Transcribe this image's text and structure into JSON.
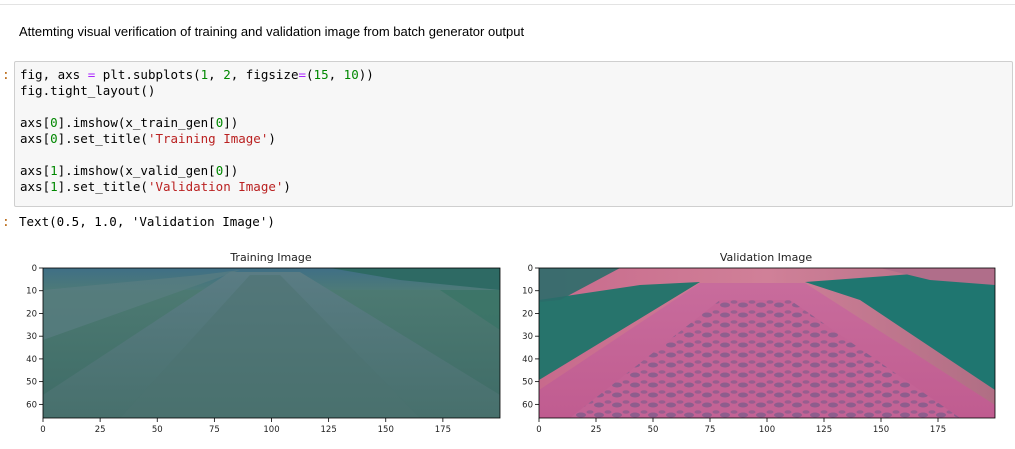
{
  "markdown": {
    "text": "Attemting visual verification of training and validation image from batch generator output"
  },
  "input_prompt": ":",
  "output_prompt": ":",
  "code_cell": {
    "lines": [
      [
        "fig, axs ",
        "=",
        " plt.subplots(",
        "1",
        ", ",
        "2",
        ", figsize",
        "=",
        "(",
        "15",
        ", ",
        "10",
        "))"
      ],
      [
        "fig.tight_layout()"
      ],
      [
        ""
      ],
      [
        "axs[",
        "0",
        "].imshow(x_train_gen[",
        "0",
        "])"
      ],
      [
        "axs[",
        "0",
        "].set_title(",
        "'Training Image'",
        ")"
      ],
      [
        ""
      ],
      [
        "axs[",
        "1",
        "].imshow(x_valid_gen[",
        "0",
        "])"
      ],
      [
        "axs[",
        "1",
        "].set_title(",
        "'Validation Image'",
        ")"
      ]
    ]
  },
  "output": {
    "text": "Text(0.5, 1.0, 'Validation Image')"
  },
  "figure": {
    "subplots": [
      {
        "title": "Training Image",
        "image_desc": "greenish road camera frame"
      },
      {
        "title": "Validation Image",
        "image_desc": "pink/teal road camera frame"
      }
    ],
    "x_ticks": [
      "0",
      "25",
      "50",
      "75",
      "100",
      "125",
      "150",
      "175"
    ],
    "y_ticks": [
      "0",
      "10",
      "20",
      "30",
      "40",
      "50",
      "60"
    ]
  }
}
